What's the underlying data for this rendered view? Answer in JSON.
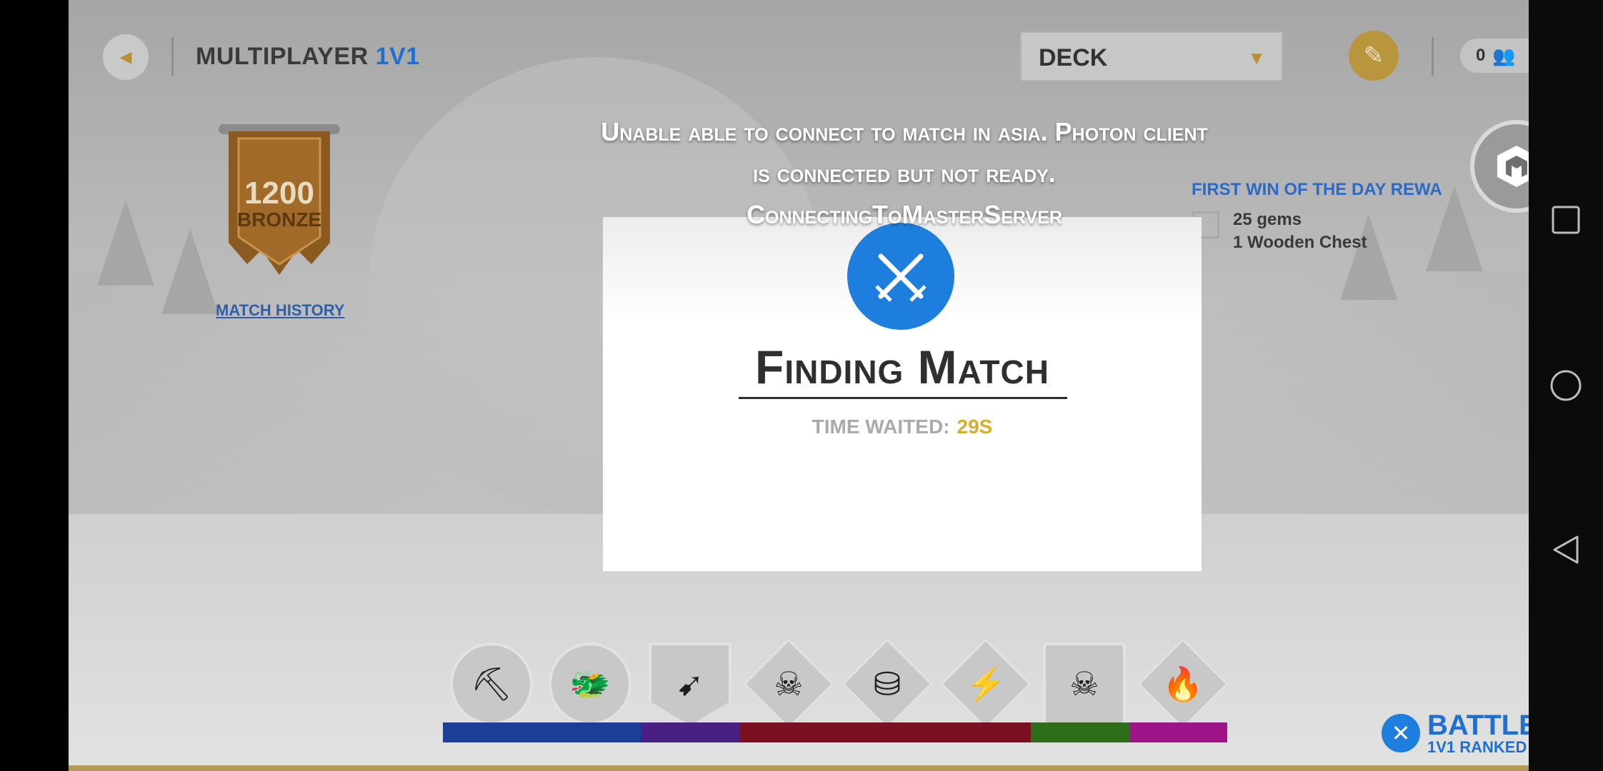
{
  "header": {
    "back_icon": "back-arrow-icon",
    "mode_title": "MULTIPLAYER",
    "mode_subtitle": "1V1",
    "deck_label": "DECK",
    "edit_icon": "pencil-icon",
    "friends_count": "0",
    "friends_icon": "friends-icon"
  },
  "rank": {
    "score": "1200",
    "tier": "BRONZE",
    "match_history_label": "MATCH HISTORY"
  },
  "first_win": {
    "title": "FIRST WIN OF THE DAY REWA",
    "reward_1": "25 gems",
    "reward_2": "1 Wooden Chest"
  },
  "error_message": "Unable able to connect to match in asia. Photon client\nis connected but not ready.\nConnectingToMasterServer",
  "dialog": {
    "title": "Finding Match",
    "time_label": "TIME WAITED:",
    "time_value": "29S",
    "badge_icon": "crossed-swords-icon"
  },
  "cards": [
    {
      "name": "pickaxe-card",
      "icon": "pickaxe-icon",
      "glyph": "⛏"
    },
    {
      "name": "dragon-card",
      "icon": "dragon-head-icon",
      "glyph": "🐉"
    },
    {
      "name": "arrows-card",
      "icon": "arrows-icon",
      "glyph": "➹"
    },
    {
      "name": "skull-strike-card",
      "icon": "skull-icon",
      "glyph": "☠"
    },
    {
      "name": "coins-card",
      "icon": "coins-icon",
      "glyph": "⛁"
    },
    {
      "name": "lightning-arrow-card",
      "icon": "lightning-arrow-icon",
      "glyph": "⚡"
    },
    {
      "name": "poison-card",
      "icon": "poison-bottle-icon",
      "glyph": "☠"
    },
    {
      "name": "fire-arrow-card",
      "icon": "fire-arrow-icon",
      "glyph": "🔥"
    }
  ],
  "elixir_colors": [
    "#1b3f96",
    "#4a1f84",
    "#7a1020",
    "#7a1020",
    "#2d6e1a",
    "#a0148a"
  ],
  "battle": {
    "label": "BATTLE",
    "sublabel": "1V1 RANKED",
    "icon": "crossed-swords-icon"
  },
  "colors": {
    "accent_blue": "#1e7ede",
    "gold": "#d8ad2c",
    "bronze": "#8a5a20"
  },
  "navbar": {
    "icons": [
      "recents-icon",
      "home-icon",
      "back-icon"
    ]
  }
}
